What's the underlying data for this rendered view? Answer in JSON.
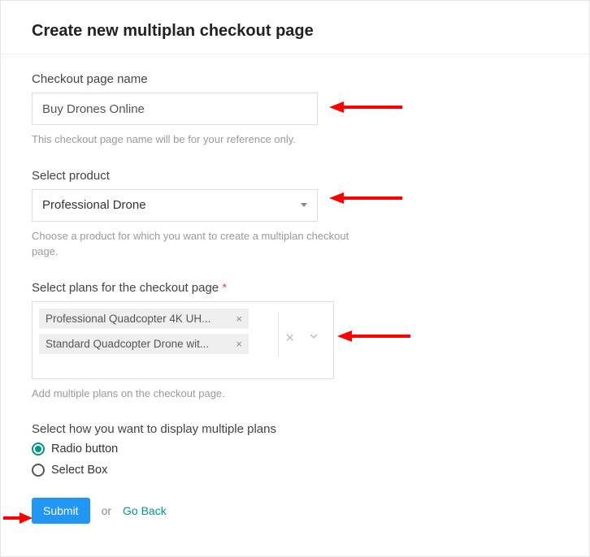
{
  "page": {
    "title": "Create new multiplan checkout page"
  },
  "fields": {
    "checkout_name": {
      "label": "Checkout page name",
      "value": "Buy Drones Online",
      "help": "This checkout page name will be for your reference only."
    },
    "product": {
      "label": "Select product",
      "selected": "Professional Drone",
      "help": "Choose a product for which you want to create a multiplan checkout page."
    },
    "plans": {
      "label": "Select plans for the checkout page",
      "required_marker": "*",
      "chips": [
        "Professional Quadcopter 4K UH...",
        "Standard Quadcopter Drone wit..."
      ],
      "help": "Add multiple plans on the checkout page."
    },
    "display_mode": {
      "label": "Select how you want to display multiple plans",
      "options": [
        {
          "label": "Radio button",
          "checked": true
        },
        {
          "label": "Select Box",
          "checked": false
        }
      ]
    }
  },
  "actions": {
    "submit": "Submit",
    "or": "or",
    "go_back": "Go Back"
  },
  "annotations": {
    "arrow_color": "#ff0000"
  }
}
